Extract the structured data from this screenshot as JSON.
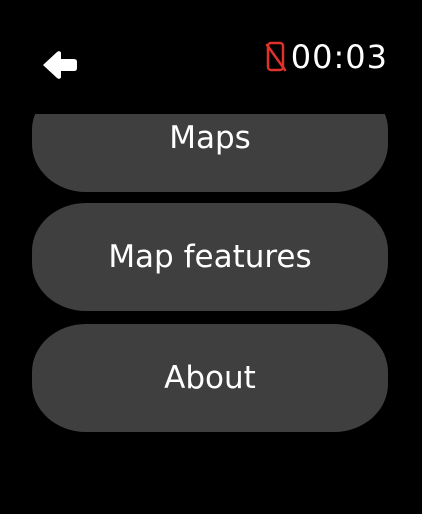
{
  "header": {
    "back_icon": "arrow-left-icon",
    "phone_status_icon": "phone-disconnected-icon",
    "phone_status_color": "#e0312b",
    "time": "00:03"
  },
  "menu": {
    "items": [
      {
        "label": "Maps"
      },
      {
        "label": "Map features"
      },
      {
        "label": "About"
      }
    ]
  },
  "colors": {
    "background": "#000000",
    "button": "#3f3f3f",
    "text": "#ffffff"
  }
}
